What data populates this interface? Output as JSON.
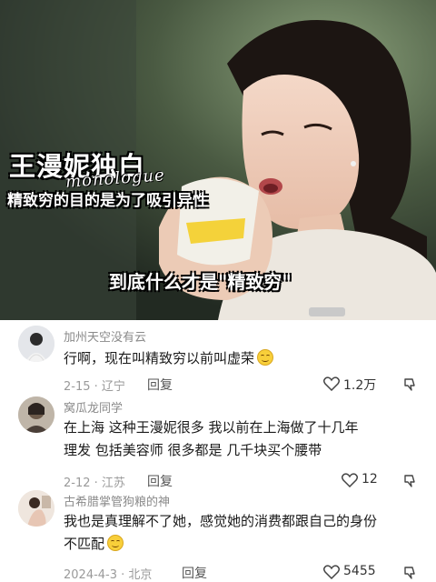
{
  "video": {
    "title": "王漫妮独白",
    "subtitle_en": "monologue",
    "tagline": "精致穷的目的是为了吸引异性",
    "center_caption": "到底什么才是\"精致穷\""
  },
  "comments": [
    {
      "username": "加州天空没有云",
      "text": "行啊，现在叫精致穷以前叫虚荣",
      "emoji": "grin-emoji",
      "date": "2-15",
      "location": "辽宁",
      "reply_label": "回复",
      "likes": "1.2万"
    },
    {
      "username": "窝瓜龙同学",
      "text_line1": "在上海 这种王漫妮很多  我以前在上海做了十几年",
      "text_line2": "理发 包括美容师 很多都是 几千块买个腰带",
      "date": "2-12",
      "location": "江苏",
      "reply_label": "回复",
      "likes": "12"
    },
    {
      "username": "古希腊掌管狗粮的神",
      "text_line1": "我也是真理解不了她，感觉她的消费都跟自己的身份",
      "text_line2": "不匹配",
      "emoji": "blush-emoji",
      "date": "2024-4-3",
      "location": "北京",
      "reply_label": "回复",
      "likes": "5455"
    }
  ],
  "colors": {
    "username": "#8a8a8a",
    "meta": "#9a9a9a",
    "text": "#1a1a1a"
  }
}
